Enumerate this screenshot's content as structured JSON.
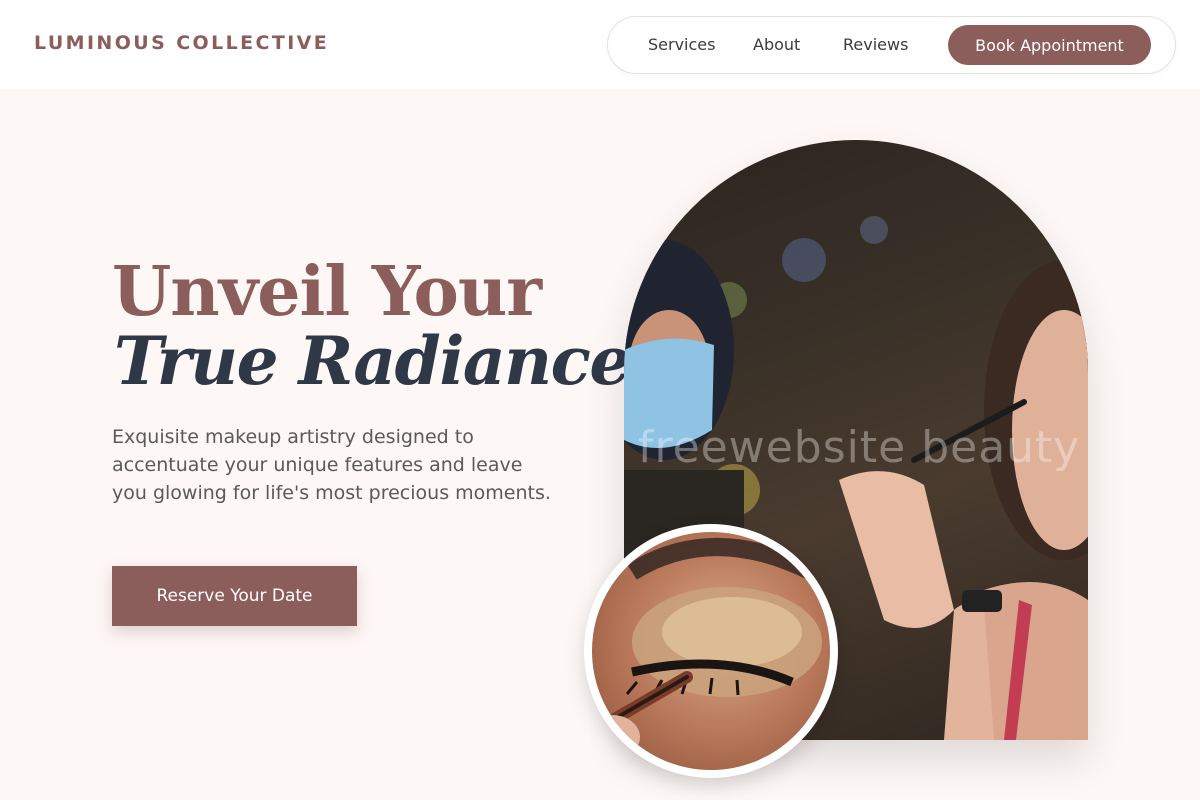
{
  "header": {
    "brand": "LUMINOUS COLLECTIVE",
    "nav": {
      "services": "Services",
      "about": "About",
      "reviews": "Reviews",
      "book": "Book Appointment"
    }
  },
  "hero": {
    "title_line1": "Unveil Your",
    "title_line2": "True Radiance",
    "subtitle": "Exquisite makeup artistry designed to accentuate your unique features and leave you glowing for life's most precious moments.",
    "cta": "Reserve Your Date"
  },
  "images": {
    "arch_watermark": "freewebsite beauty"
  },
  "colors": {
    "accent": "#8b5e5c",
    "heading_dark": "#2f3847",
    "background": "#fdf7f5"
  }
}
